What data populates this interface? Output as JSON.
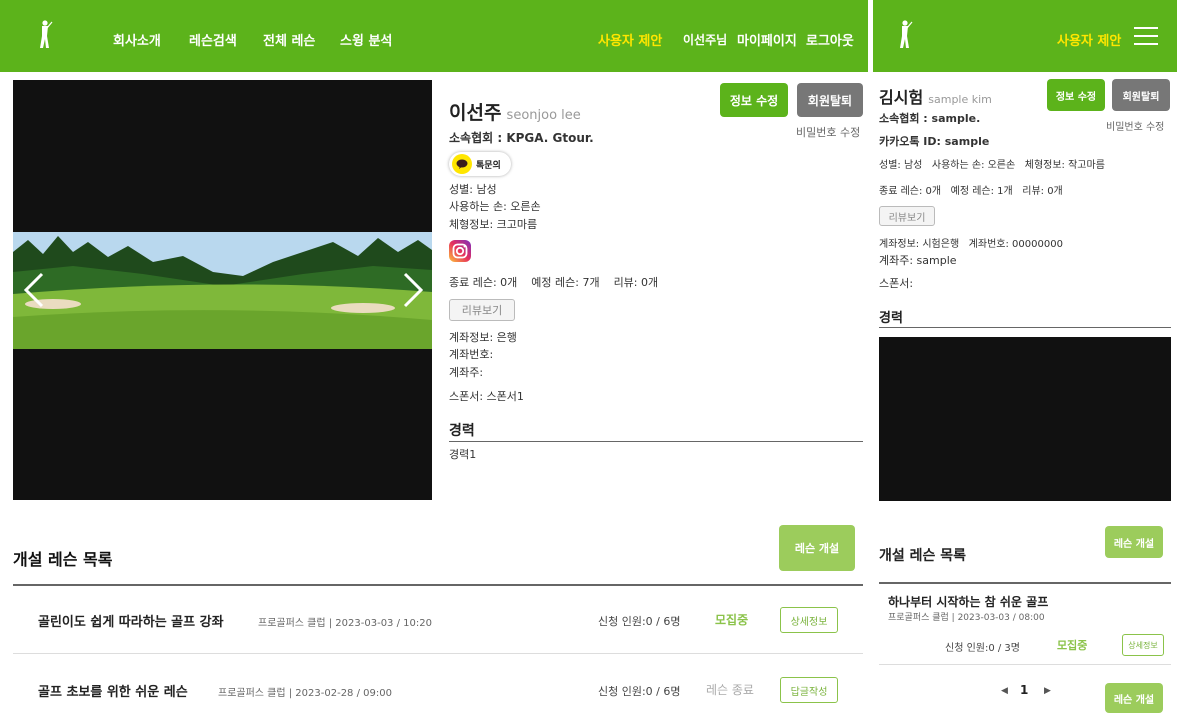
{
  "header": {
    "nav": [
      "회사소개",
      "레슨검색",
      "전체 레슨",
      "스윙 분석"
    ],
    "suggest": "사용자 제안",
    "username": "이선주님",
    "mypage": "마이페이지",
    "logout": "로그아웃"
  },
  "profile": {
    "name": "이선주",
    "name_en": "seonjoo lee",
    "association": "소속협회 : KPGA. Gtour.",
    "kakao_label": "톡문의",
    "gender": "성별: 남성",
    "hand": "사용하는 손: 오른손",
    "body": "체형정보: 크고마름",
    "lessons": "종료 레슨: 0개    예정 레슨: 7개    리뷰: 0개",
    "review_btn": "리뷰보기",
    "bank": "계좌정보: 은행",
    "account_no": "계좌번호:",
    "account_owner": "계좌주:",
    "sponsor": "스폰서: 스폰서1",
    "career_title": "경력",
    "career": "경력1",
    "edit_btn": "정보 수정",
    "withdraw_btn": "회원탈퇴",
    "pw_change": "비밀번호 수정"
  },
  "lessons_section": {
    "title": "개설 레슨 목록",
    "open_btn": "레슨 개설",
    "rows": [
      {
        "title": "골린이도 쉽게 따라하는 골프 강좌",
        "meta": "프로골퍼스 클럽 | 2023-03-03 / 10:20",
        "count": "신청 인원:0 / 6명",
        "status": "모집중",
        "action": "상세정보"
      },
      {
        "title": "골프 초보를 위한 쉬운 레슨",
        "meta": "프로골퍼스 클럽 | 2023-02-28 / 09:00",
        "count": "신청 인원:0 / 6명",
        "status": "레슨 종료",
        "action": "답글작성"
      }
    ]
  },
  "mobile": {
    "suggest": "사용자 제안",
    "name": "김시험",
    "name_en": "sample kim",
    "edit_btn": "정보 수정",
    "withdraw_btn": "회원탈퇴",
    "pw_change": "비밀번호 수정",
    "association": "소속협회 : sample.",
    "kakao_id": "카카오톡 ID: sample",
    "profile_line": "성별: 남성   사용하는 손: 오른손   체형정보: 작고마름",
    "lessons": "종료 레슨: 0개   예정 레슨: 1개   리뷰: 0개",
    "review_btn": "리뷰보기",
    "bank": "계좌정보: 시험은행   계좌번호: 00000000",
    "account_owner": "계좌주: sample",
    "sponsor": "스폰서:",
    "career_title": "경력",
    "list_title": "개설 레슨 목록",
    "open_btn": "레슨 개설",
    "lesson_title": "하나부터 시작하는 참 쉬운 골프",
    "lesson_meta": "프로골퍼스 클럽 | 2023-03-03 / 08:00",
    "lesson_count": "신청 인원:0 / 3명",
    "lesson_status": "모집중",
    "lesson_action": "상세정보",
    "page": "1",
    "open_btn2": "레슨 개설"
  },
  "colors": {
    "brand": "#5cb31b",
    "accent_yellow": "#ffe600",
    "light_green": "#9ccc5c"
  }
}
